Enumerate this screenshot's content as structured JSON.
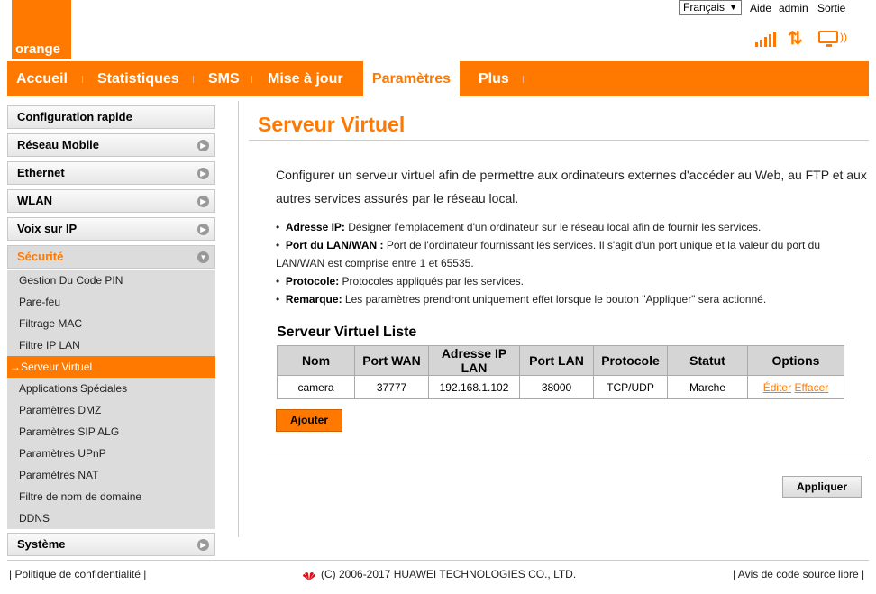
{
  "header": {
    "logo_text": "orange",
    "language": "Français",
    "links": [
      "Aide",
      "admin",
      "Sortie"
    ],
    "status_icons": [
      "signal-icon",
      "transfer-icon",
      "tv-icon"
    ],
    "accent_color": "#ff7900"
  },
  "nav": {
    "items": [
      "Accueil",
      "Statistiques",
      "SMS",
      "Mise à jour",
      "Paramètres",
      "Plus"
    ],
    "active": "Paramètres"
  },
  "sidebar": {
    "sections": [
      "Configuration rapide",
      "Réseau Mobile",
      "Ethernet",
      "WLAN",
      "Voix sur IP",
      "Sécurité",
      "Système"
    ],
    "open_section": "Sécurité",
    "submenu": [
      "Gestion Du Code PIN",
      "Pare-feu",
      "Filtrage MAC",
      "Filtre IP LAN",
      "Serveur Virtuel",
      "Applications Spéciales",
      "Paramètres DMZ",
      "Paramètres SIP ALG",
      "Paramètres UPnP",
      "Paramètres NAT",
      "Filtre de nom de domaine",
      "DDNS"
    ],
    "active_item": "Serveur Virtuel",
    "active_marker": "→"
  },
  "main": {
    "title": "Serveur Virtuel",
    "intro": "Configurer un serveur virtuel afin de permettre aux ordinateurs externes d'accéder au Web, au FTP et aux autres services assurés par le réseau local.",
    "bullets": [
      {
        "label": "Adresse IP:",
        "text": " Désigner l'emplacement d'un ordinateur sur le réseau local afin de fournir les services."
      },
      {
        "label": "Port du LAN/WAN :",
        "text": " Port de l'ordinateur fournissant les services. Il s'agit d'un port unique et la valeur du port du LAN/WAN est comprise entre 1 et 65535."
      },
      {
        "label": "Protocole:",
        "text": " Protocoles appliqués par les services."
      },
      {
        "label": "Remarque:",
        "text": " Les paramètres prendront uniquement effet lorsque le bouton \"Appliquer\" sera actionné."
      }
    ],
    "list_title": "Serveur Virtuel Liste",
    "table": {
      "headers": [
        "Nom",
        "Port WAN",
        "Adresse IP LAN",
        "Port LAN",
        "Protocole",
        "Statut",
        "Options"
      ],
      "rows": [
        {
          "name": "camera",
          "port_wan": "37777",
          "ip_lan": "192.168.1.102",
          "port_lan": "38000",
          "protocol": "TCP/UDP",
          "status": "Marche",
          "edit": "Éditer",
          "delete": "Effacer"
        }
      ]
    },
    "add_button": "Ajouter",
    "apply_button": "Appliquer"
  },
  "footer": {
    "privacy": "Politique de confidentialité",
    "copyright": "(C) 2006-2017 HUAWEI TECHNOLOGIES CO., LTD.",
    "open_source": "Avis de code source libre"
  }
}
